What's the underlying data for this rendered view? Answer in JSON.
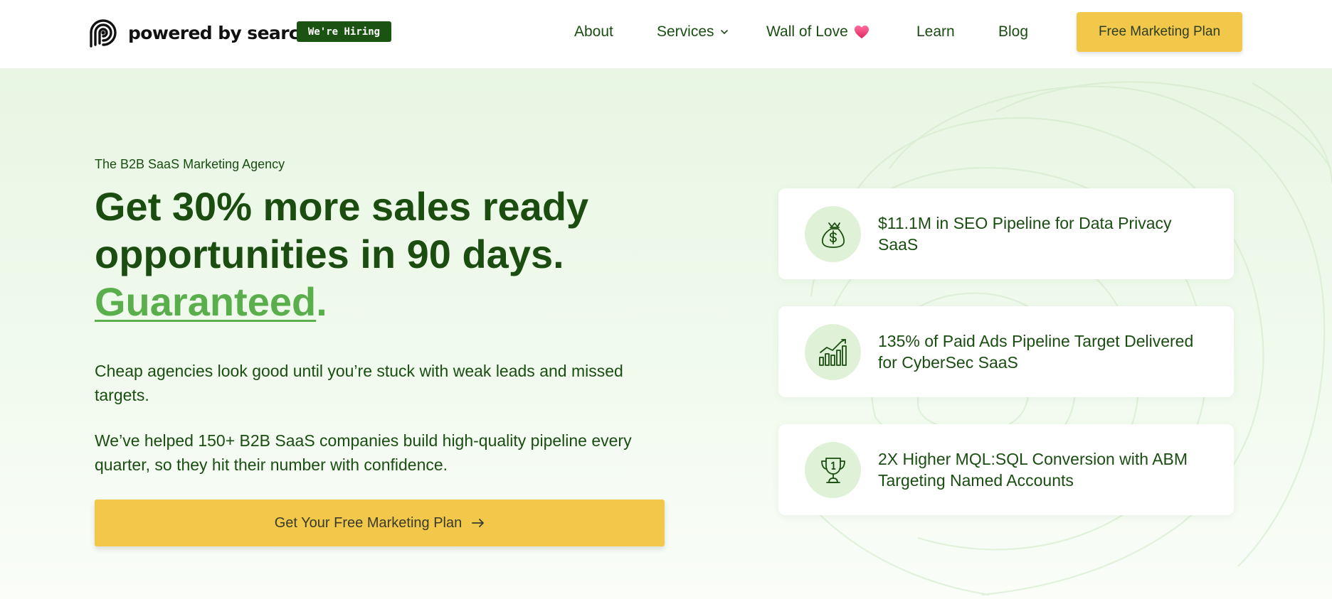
{
  "header": {
    "logo_text": "powered by search",
    "hiring_badge": "We're Hiring",
    "nav": {
      "about": "About",
      "services": "Services",
      "wall_of_love": "Wall of Love",
      "learn": "Learn",
      "blog": "Blog"
    },
    "cta": "Free Marketing Plan"
  },
  "hero": {
    "eyebrow": "The B2B SaaS Marketing Agency",
    "headline_line1": "Get 30% more sales ready",
    "headline_line2": "opportunities in 90 days.",
    "headline_accent": "Guaranteed",
    "headline_period": ".",
    "paragraph1": "Cheap agencies look good until you’re stuck with weak leads and missed targets.",
    "paragraph2": "We’ve helped 150+ B2B SaaS companies build high-quality pipeline every quarter, so they hit their number with confidence.",
    "cta": "Get Your Free Marketing Plan"
  },
  "stats": [
    {
      "icon": "money-bag-icon",
      "text": "$11.1M in SEO Pipeline for Data Privacy SaaS"
    },
    {
      "icon": "growth-chart-icon",
      "text": "135% of Paid Ads Pipeline Target Delivered for CyberSec SaaS"
    },
    {
      "icon": "trophy-icon",
      "text": "2X Higher MQL:SQL Conversion with ABM Targeting Named Accounts"
    }
  ],
  "colors": {
    "brand_green": "#1b4d10",
    "accent_green": "#5aaf4c",
    "cta_yellow": "#f2c84b",
    "hero_background": "#e8f6e3",
    "icon_circle": "#dff2d8"
  }
}
